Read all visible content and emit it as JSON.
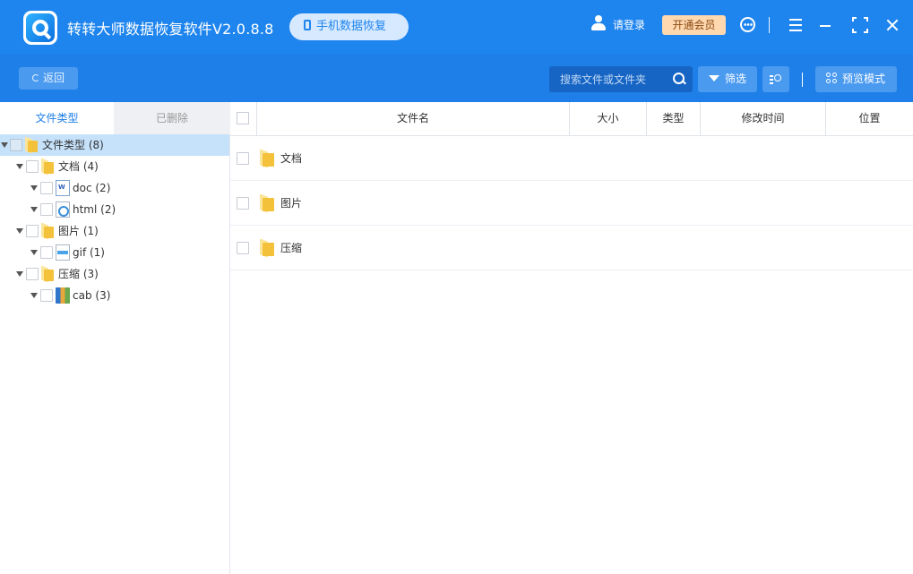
{
  "app": {
    "title": "转转大师数据恢复软件V2.0.8.8",
    "mobile_recovery": "手机数据恢复",
    "login": "请登录",
    "vip": "开通会员"
  },
  "toolbar": {
    "back": "返回",
    "search_placeholder": "搜索文件或文件夹",
    "filter": "筛选",
    "preview_mode": "预览模式"
  },
  "left_tabs": {
    "file_types": "文件类型",
    "deleted": "已删除"
  },
  "tree": [
    {
      "label": "文件类型 (8)",
      "icon": "folder-icon",
      "level": 0,
      "selected": true
    },
    {
      "label": "文档 (4)",
      "icon": "folder-icon",
      "level": 1
    },
    {
      "label": "doc (2)",
      "icon": "word-doc-icon",
      "level": 2
    },
    {
      "label": "html (2)",
      "icon": "html-file-icon",
      "level": 2
    },
    {
      "label": "图片 (1)",
      "icon": "folder-icon",
      "level": 1
    },
    {
      "label": "gif (1)",
      "icon": "gif-file-icon",
      "level": 2
    },
    {
      "label": "压缩 (3)",
      "icon": "folder-icon",
      "level": 1
    },
    {
      "label": "cab (3)",
      "icon": "archive-icon",
      "level": 2
    }
  ],
  "columns": {
    "name": "文件名",
    "size": "大小",
    "type": "类型",
    "modified": "修改时间",
    "location": "位置"
  },
  "rows": [
    {
      "name": "文档"
    },
    {
      "name": "图片"
    },
    {
      "name": "压缩"
    }
  ],
  "colors": {
    "titlebar": "#1f85ee",
    "toolbar": "#1e7fe8",
    "accent": "#1e7fe8",
    "selected_row": "#c6e2fb",
    "vip": "#ffd8b0"
  }
}
